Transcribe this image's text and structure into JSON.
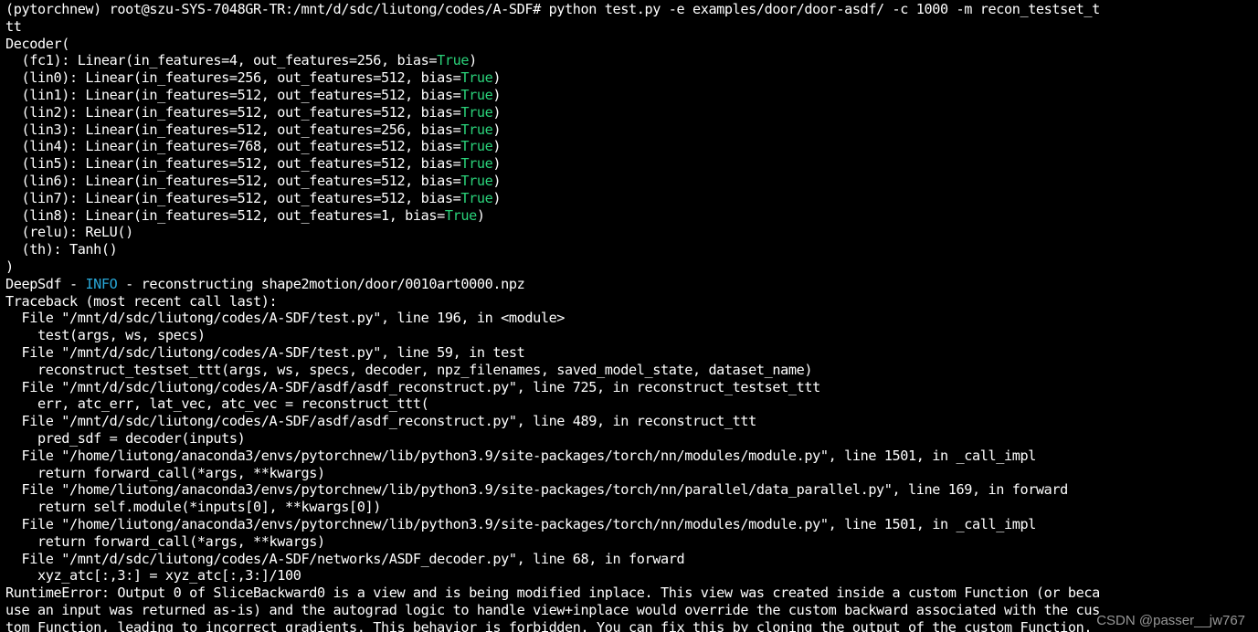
{
  "terminal": {
    "prompt_line": "(pytorchnew) root@szu-SYS-7048GR-TR:/mnt/d/sdc/liutong/codes/A-SDF# python test.py -e examples/door/door-asdf/ -c 1000 -m recon_testset_t",
    "prompt_wrap": "tt",
    "decoder_open": "Decoder(",
    "layers": [
      {
        "prefix": "  (fc1): Linear(in_features=4, out_features=256, bias=",
        "flag": "True",
        "suffix": ")"
      },
      {
        "prefix": "  (lin0): Linear(in_features=256, out_features=512, bias=",
        "flag": "True",
        "suffix": ")"
      },
      {
        "prefix": "  (lin1): Linear(in_features=512, out_features=512, bias=",
        "flag": "True",
        "suffix": ")"
      },
      {
        "prefix": "  (lin2): Linear(in_features=512, out_features=512, bias=",
        "flag": "True",
        "suffix": ")"
      },
      {
        "prefix": "  (lin3): Linear(in_features=512, out_features=256, bias=",
        "flag": "True",
        "suffix": ")"
      },
      {
        "prefix": "  (lin4): Linear(in_features=768, out_features=512, bias=",
        "flag": "True",
        "suffix": ")"
      },
      {
        "prefix": "  (lin5): Linear(in_features=512, out_features=512, bias=",
        "flag": "True",
        "suffix": ")"
      },
      {
        "prefix": "  (lin6): Linear(in_features=512, out_features=512, bias=",
        "flag": "True",
        "suffix": ")"
      },
      {
        "prefix": "  (lin7): Linear(in_features=512, out_features=512, bias=",
        "flag": "True",
        "suffix": ")"
      },
      {
        "prefix": "  (lin8): Linear(in_features=512, out_features=1, bias=",
        "flag": "True",
        "suffix": ")"
      }
    ],
    "relu_line": "  (relu): ReLU()",
    "th_line": "  (th): Tanh()",
    "decoder_close": ")",
    "log": {
      "prefix": "DeepSdf - ",
      "level": "INFO",
      "message": " - reconstructing shape2motion/door/0010art0000.npz"
    },
    "traceback_header": "Traceback (most recent call last):",
    "traceback": [
      "  File \"/mnt/d/sdc/liutong/codes/A-SDF/test.py\", line 196, in <module>",
      "    test(args, ws, specs)",
      "  File \"/mnt/d/sdc/liutong/codes/A-SDF/test.py\", line 59, in test",
      "    reconstruct_testset_ttt(args, ws, specs, decoder, npz_filenames, saved_model_state, dataset_name)",
      "  File \"/mnt/d/sdc/liutong/codes/A-SDF/asdf/asdf_reconstruct.py\", line 725, in reconstruct_testset_ttt",
      "    err, atc_err, lat_vec, atc_vec = reconstruct_ttt(",
      "  File \"/mnt/d/sdc/liutong/codes/A-SDF/asdf/asdf_reconstruct.py\", line 489, in reconstruct_ttt",
      "    pred_sdf = decoder(inputs)",
      "  File \"/home/liutong/anaconda3/envs/pytorchnew/lib/python3.9/site-packages/torch/nn/modules/module.py\", line 1501, in _call_impl",
      "    return forward_call(*args, **kwargs)",
      "  File \"/home/liutong/anaconda3/envs/pytorchnew/lib/python3.9/site-packages/torch/nn/parallel/data_parallel.py\", line 169, in forward",
      "    return self.module(*inputs[0], **kwargs[0])",
      "  File \"/home/liutong/anaconda3/envs/pytorchnew/lib/python3.9/site-packages/torch/nn/modules/module.py\", line 1501, in _call_impl",
      "    return forward_call(*args, **kwargs)",
      "  File \"/mnt/d/sdc/liutong/codes/A-SDF/networks/ASDF_decoder.py\", line 68, in forward",
      "    xyz_atc[:,3:] = xyz_atc[:,3:]/100"
    ],
    "error": [
      "RuntimeError: Output 0 of SliceBackward0 is a view and is being modified inplace. This view was created inside a custom Function (or beca",
      "use an input was returned as-is) and the autograd logic to handle view+inplace would override the custom backward associated with the cus",
      "tom Function, leading to incorrect gradients. This behavior is forbidden. You can fix this by cloning the output of the custom Function."
    ]
  },
  "watermark": "CSDN @passer__jw767",
  "colors": {
    "background": "#000000",
    "text": "#ffffff",
    "keyword_true": "#2ad27a",
    "log_level": "#29a8d9"
  }
}
